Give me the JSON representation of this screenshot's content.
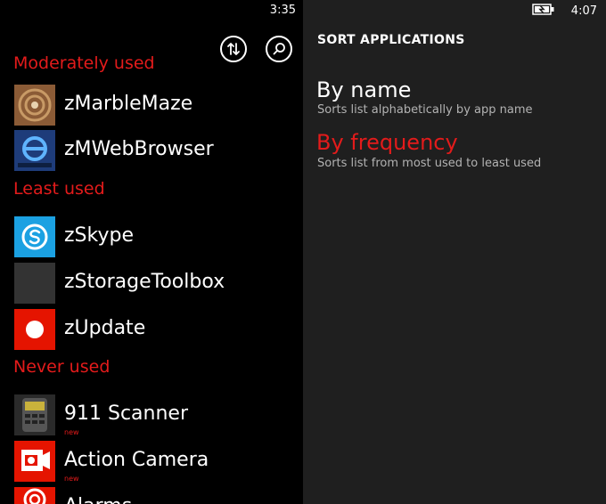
{
  "left_panel": {
    "time": "3:35",
    "sections": [
      {
        "label": "Moderately used",
        "apps": [
          {
            "name": "zMarbleMaze",
            "icon": "marble-maze-icon"
          },
          {
            "name": "zMWebBrowser",
            "icon": "web-browser-icon"
          }
        ]
      },
      {
        "label": "Least used",
        "apps": [
          {
            "name": "zSkype",
            "icon": "skype-icon"
          },
          {
            "name": "zStorageToolbox",
            "icon": "storage-toolbox-icon"
          },
          {
            "name": "zUpdate",
            "icon": "update-icon"
          }
        ]
      },
      {
        "label": "Never used",
        "apps": [
          {
            "name": "911 Scanner",
            "badge": "new",
            "icon": "scanner-icon"
          },
          {
            "name": "Action Camera",
            "badge": "new",
            "icon": "camera-icon"
          },
          {
            "name": "Alarms",
            "icon": "alarm-icon"
          }
        ]
      }
    ],
    "buttons": [
      {
        "icon": "sort-arrows-icon"
      },
      {
        "icon": "search-icon"
      }
    ]
  },
  "right_panel": {
    "time": "4:07",
    "battery_icon": "battery-charging-icon",
    "title": "SORT APPLICATIONS",
    "options": [
      {
        "label": "By name",
        "description": "Sorts list alphabetically by app name",
        "selected": false
      },
      {
        "label": "By frequency",
        "description": "Sorts list from most used to least used",
        "selected": true
      }
    ]
  },
  "colors": {
    "accent": "#e31b1b",
    "left_background": "#000000",
    "right_background": "#1f1f1f",
    "text": "#ffffff",
    "subtext": "#b3b3b3"
  }
}
